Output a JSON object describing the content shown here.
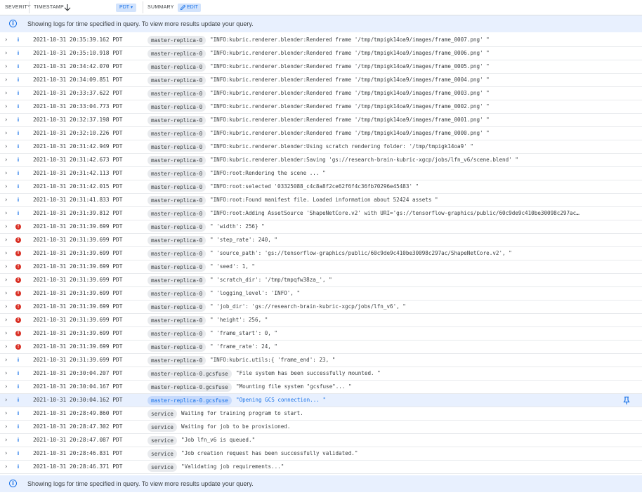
{
  "header": {
    "severity": "SEVERITY",
    "timestamp": "TIMESTAMP",
    "sort_icon": "arrow-down-icon",
    "timezone": "PDT",
    "summary": "SUMMARY",
    "edit": "EDIT"
  },
  "banner": {
    "text": "Showing logs for time specified in query. To view more results update your query."
  },
  "colors": {
    "accent": "#1a73e8",
    "error": "#d93025",
    "selected_row": "#e8f0fe",
    "chip": "#e8eaed"
  },
  "rows": [
    {
      "severity": "info",
      "timestamp": "2021-10-31 20:35:39.162 PDT",
      "source": "master-replica-0",
      "message": "\"INFO:kubric.renderer.blender:Rendered frame '/tmp/tmpigk14oa9/images/frame_0007.png' \""
    },
    {
      "severity": "info",
      "timestamp": "2021-10-31 20:35:10.918 PDT",
      "source": "master-replica-0",
      "message": "\"INFO:kubric.renderer.blender:Rendered frame '/tmp/tmpigk14oa9/images/frame_0006.png' \""
    },
    {
      "severity": "info",
      "timestamp": "2021-10-31 20:34:42.070 PDT",
      "source": "master-replica-0",
      "message": "\"INFO:kubric.renderer.blender:Rendered frame '/tmp/tmpigk14oa9/images/frame_0005.png' \""
    },
    {
      "severity": "info",
      "timestamp": "2021-10-31 20:34:09.851 PDT",
      "source": "master-replica-0",
      "message": "\"INFO:kubric.renderer.blender:Rendered frame '/tmp/tmpigk14oa9/images/frame_0004.png' \""
    },
    {
      "severity": "info",
      "timestamp": "2021-10-31 20:33:37.622 PDT",
      "source": "master-replica-0",
      "message": "\"INFO:kubric.renderer.blender:Rendered frame '/tmp/tmpigk14oa9/images/frame_0003.png' \""
    },
    {
      "severity": "info",
      "timestamp": "2021-10-31 20:33:04.773 PDT",
      "source": "master-replica-0",
      "message": "\"INFO:kubric.renderer.blender:Rendered frame '/tmp/tmpigk14oa9/images/frame_0002.png' \""
    },
    {
      "severity": "info",
      "timestamp": "2021-10-31 20:32:37.198 PDT",
      "source": "master-replica-0",
      "message": "\"INFO:kubric.renderer.blender:Rendered frame '/tmp/tmpigk14oa9/images/frame_0001.png' \""
    },
    {
      "severity": "info",
      "timestamp": "2021-10-31 20:32:10.226 PDT",
      "source": "master-replica-0",
      "message": "\"INFO:kubric.renderer.blender:Rendered frame '/tmp/tmpigk14oa9/images/frame_0000.png' \""
    },
    {
      "severity": "info",
      "timestamp": "2021-10-31 20:31:42.949 PDT",
      "source": "master-replica-0",
      "message": "\"INFO:kubric.renderer.blender:Using scratch rendering folder: '/tmp/tmpigk14oa9' \""
    },
    {
      "severity": "info",
      "timestamp": "2021-10-31 20:31:42.673 PDT",
      "source": "master-replica-0",
      "message": "\"INFO:kubric.renderer.blender:Saving 'gs://research-brain-kubric-xgcp/jobs/lfn_v6/scene.blend' \""
    },
    {
      "severity": "info",
      "timestamp": "2021-10-31 20:31:42.113 PDT",
      "source": "master-replica-0",
      "message": "\"INFO:root:Rendering the scene ... \""
    },
    {
      "severity": "info",
      "timestamp": "2021-10-31 20:31:42.015 PDT",
      "source": "master-replica-0",
      "message": "\"INFO:root:selected '03325088_c4c8a8f2ce62f6f4c36fb70296e45483' \""
    },
    {
      "severity": "info",
      "timestamp": "2021-10-31 20:31:41.833 PDT",
      "source": "master-replica-0",
      "message": "\"INFO:root:Found manifest file. Loaded information about 52424 assets \""
    },
    {
      "severity": "info",
      "timestamp": "2021-10-31 20:31:39.812 PDT",
      "source": "master-replica-0",
      "message": "\"INFO:root:Adding AssetSource 'ShapeNetCore.v2' with URI='gs://tensorflow-graphics/public/60c9de9c410be30098c297ac…"
    },
    {
      "severity": "error",
      "timestamp": "2021-10-31 20:31:39.699 PDT",
      "source": "master-replica-0",
      "message": "\" 'width': 256} \""
    },
    {
      "severity": "error",
      "timestamp": "2021-10-31 20:31:39.699 PDT",
      "source": "master-replica-0",
      "message": "\" 'step_rate': 240, \""
    },
    {
      "severity": "error",
      "timestamp": "2021-10-31 20:31:39.699 PDT",
      "source": "master-replica-0",
      "message": "\" 'source_path': 'gs://tensorflow-graphics/public/60c9de9c410be30098c297ac/ShapeNetCore.v2', \""
    },
    {
      "severity": "error",
      "timestamp": "2021-10-31 20:31:39.699 PDT",
      "source": "master-replica-0",
      "message": "\" 'seed': 1, \""
    },
    {
      "severity": "error",
      "timestamp": "2021-10-31 20:31:39.699 PDT",
      "source": "master-replica-0",
      "message": "\" 'scratch_dir': '/tmp/tmpqfw38za_', \""
    },
    {
      "severity": "error",
      "timestamp": "2021-10-31 20:31:39.699 PDT",
      "source": "master-replica-0",
      "message": "\" 'logging_level': 'INFO', \""
    },
    {
      "severity": "error",
      "timestamp": "2021-10-31 20:31:39.699 PDT",
      "source": "master-replica-0",
      "message": "\" 'job_dir': 'gs://research-brain-kubric-xgcp/jobs/lfn_v6', \""
    },
    {
      "severity": "error",
      "timestamp": "2021-10-31 20:31:39.699 PDT",
      "source": "master-replica-0",
      "message": "\" 'height': 256, \""
    },
    {
      "severity": "error",
      "timestamp": "2021-10-31 20:31:39.699 PDT",
      "source": "master-replica-0",
      "message": "\" 'frame_start': 0, \""
    },
    {
      "severity": "error",
      "timestamp": "2021-10-31 20:31:39.699 PDT",
      "source": "master-replica-0",
      "message": "\" 'frame_rate': 24, \""
    },
    {
      "severity": "info",
      "timestamp": "2021-10-31 20:31:39.699 PDT",
      "source": "master-replica-0",
      "message": "\"INFO:kubric.utils:{ 'frame_end': 23, \""
    },
    {
      "severity": "info",
      "timestamp": "2021-10-31 20:30:04.207 PDT",
      "source": "master-replica-0.gcsfuse",
      "message": "\"File system has been successfully mounted. \""
    },
    {
      "severity": "info",
      "timestamp": "2021-10-31 20:30:04.167 PDT",
      "source": "master-replica-0.gcsfuse",
      "message": "\"Mounting file system \"gcsfuse\"... \""
    },
    {
      "severity": "info",
      "timestamp": "2021-10-31 20:30:04.162 PDT",
      "source": "master-replica-0.gcsfuse",
      "message": "\"Opening GCS connection... \"",
      "selected": true
    },
    {
      "severity": "info",
      "timestamp": "2021-10-31 20:28:49.860 PDT",
      "source": "service",
      "message": "Waiting for training program to start."
    },
    {
      "severity": "info",
      "timestamp": "2021-10-31 20:28:47.302 PDT",
      "source": "service",
      "message": "Waiting for job to be provisioned."
    },
    {
      "severity": "info",
      "timestamp": "2021-10-31 20:28:47.087 PDT",
      "source": "service",
      "message": "\"Job lfn_v6 is queued.\""
    },
    {
      "severity": "info",
      "timestamp": "2021-10-31 20:28:46.831 PDT",
      "source": "service",
      "message": "\"Job creation request has been successfully validated.\""
    },
    {
      "severity": "info",
      "timestamp": "2021-10-31 20:28:46.371 PDT",
      "source": "service",
      "message": "\"Validating job requirements...\""
    }
  ]
}
